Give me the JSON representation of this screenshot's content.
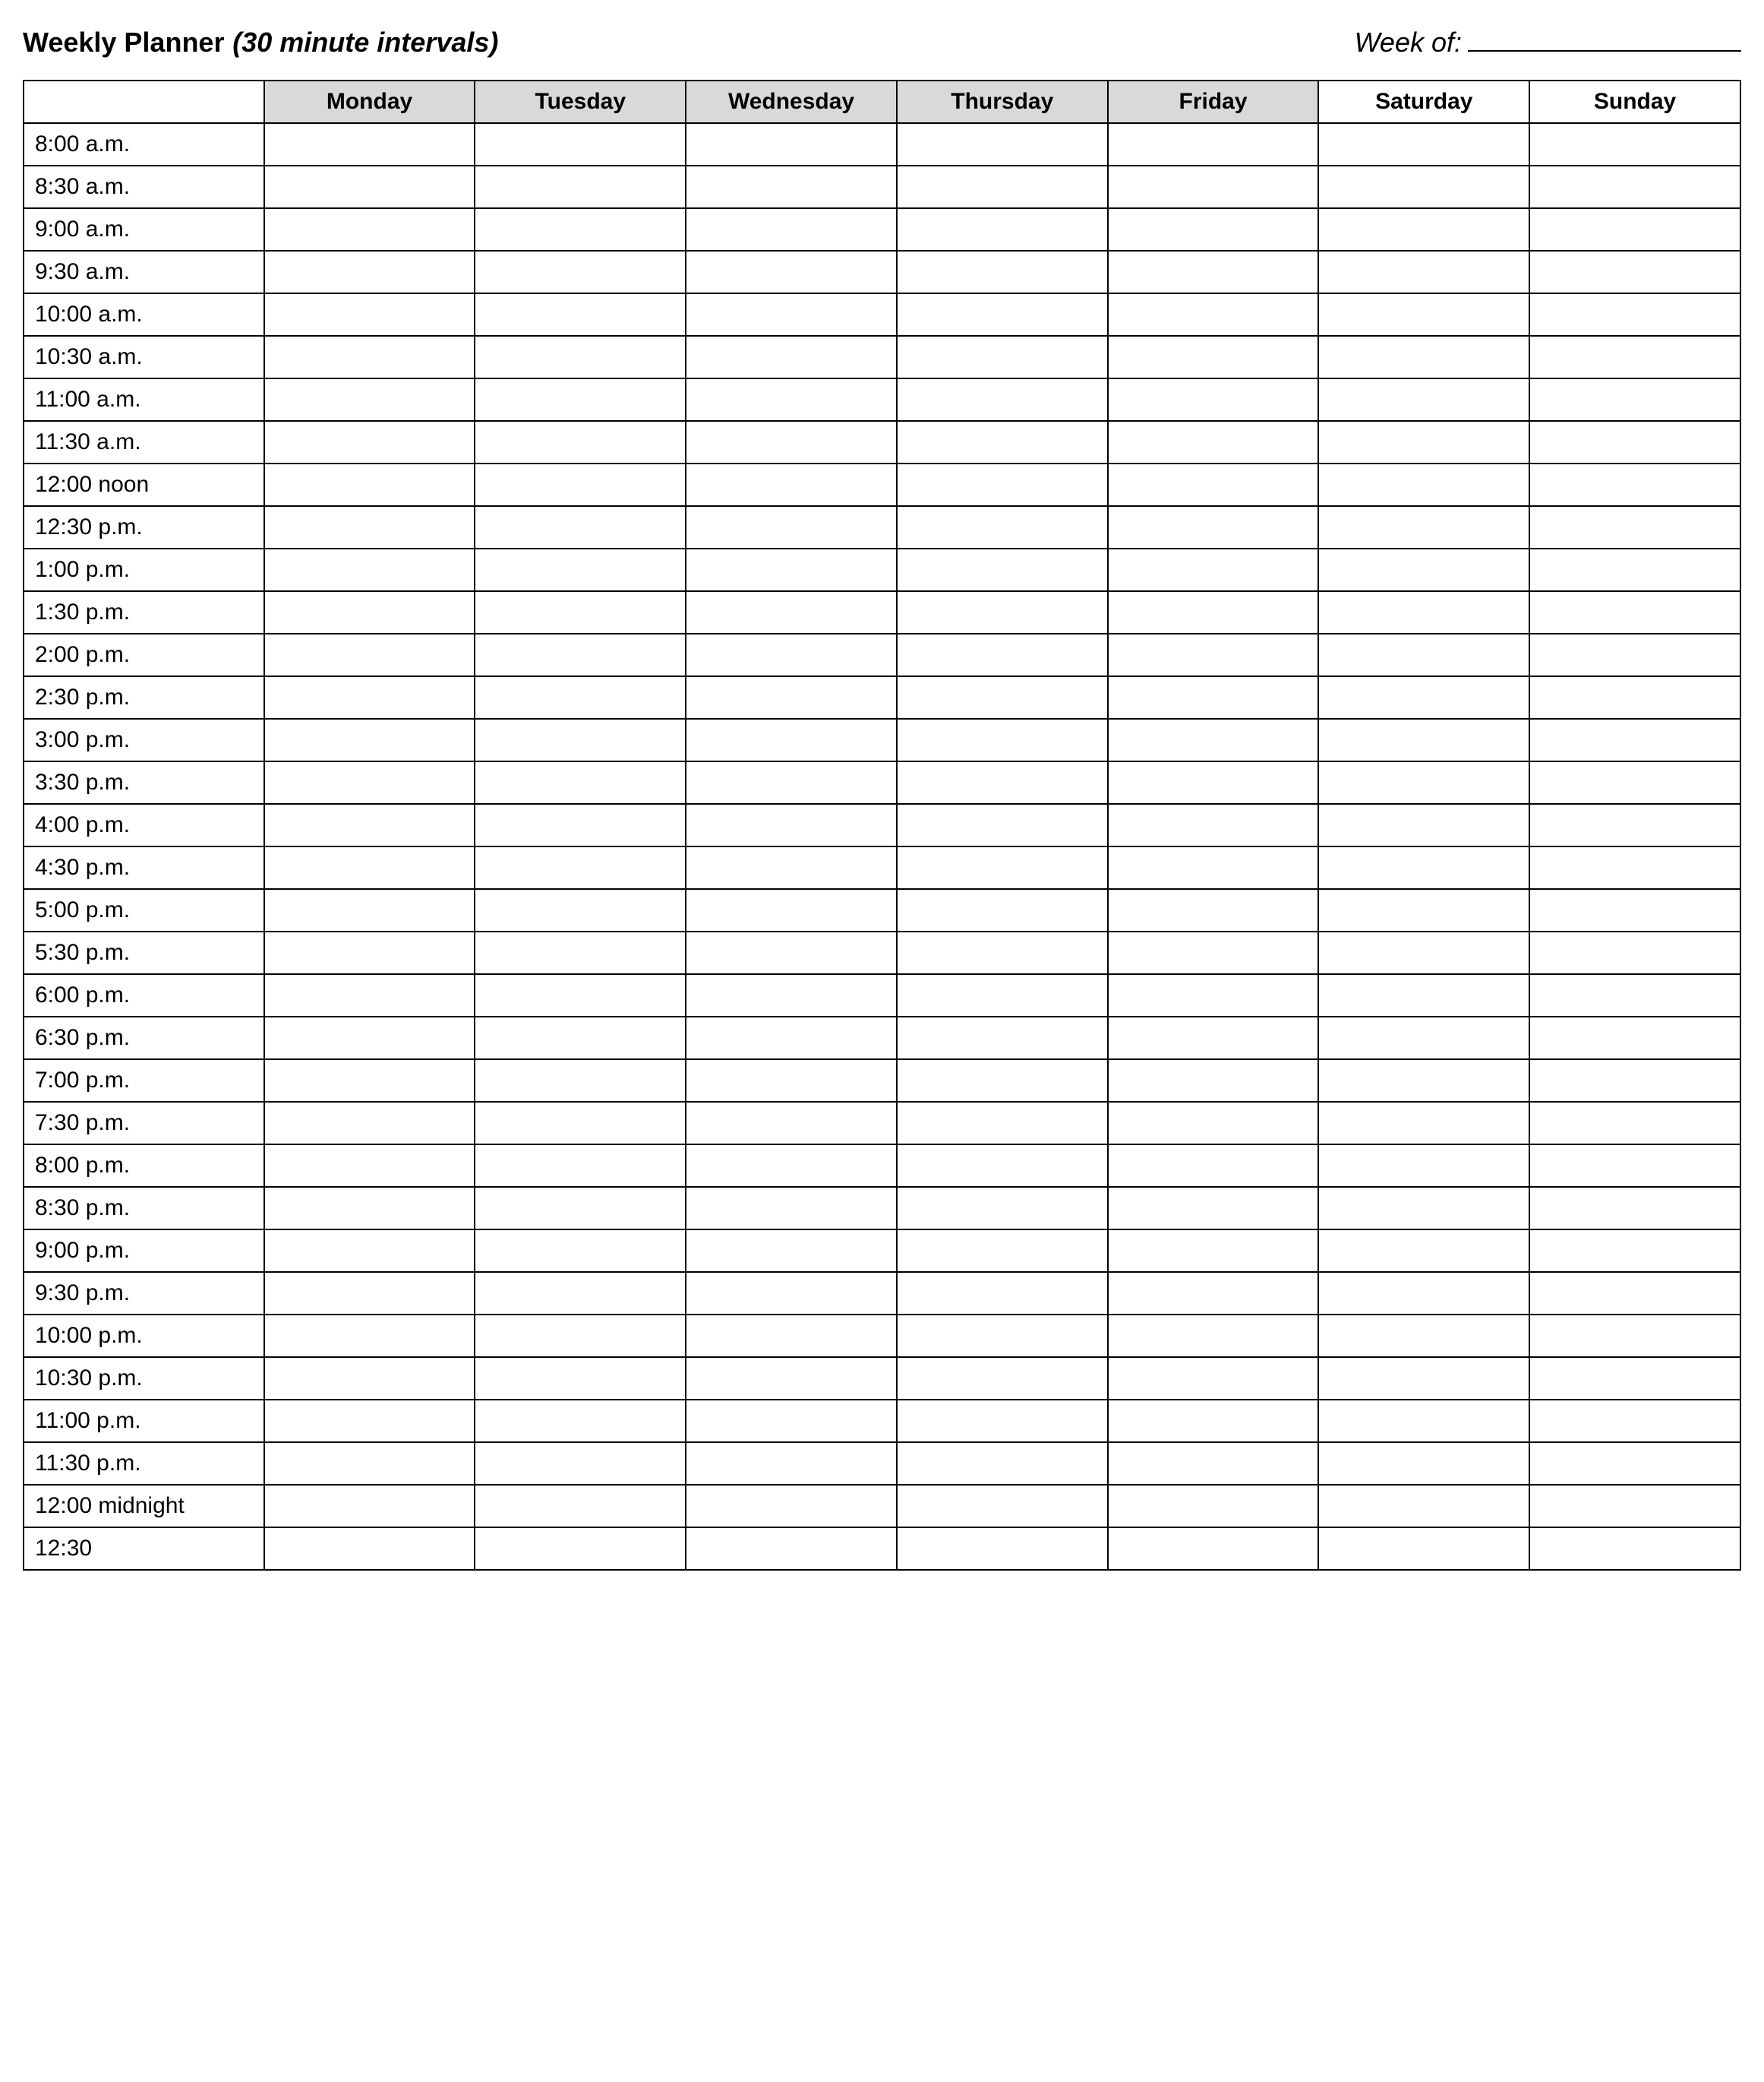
{
  "header": {
    "title_main": "Weekly Planner",
    "title_sub": "(30 minute intervals)",
    "weekof_label": "Week of:",
    "weekof_value": ""
  },
  "days": [
    {
      "label": "Monday",
      "shaded": true
    },
    {
      "label": "Tuesday",
      "shaded": true
    },
    {
      "label": "Wednesday",
      "shaded": true
    },
    {
      "label": "Thursday",
      "shaded": true
    },
    {
      "label": "Friday",
      "shaded": true
    },
    {
      "label": "Saturday",
      "shaded": false
    },
    {
      "label": "Sunday",
      "shaded": false
    }
  ],
  "times": [
    "8:00 a.m.",
    "8:30 a.m.",
    "9:00 a.m.",
    "9:30 a.m.",
    "10:00 a.m.",
    "10:30 a.m.",
    "11:00 a.m.",
    "11:30 a.m.",
    "12:00 noon",
    "12:30 p.m.",
    "1:00 p.m.",
    "1:30 p.m.",
    "2:00 p.m.",
    "2:30 p.m.",
    "3:00 p.m.",
    "3:30 p.m.",
    "4:00 p.m.",
    "4:30 p.m.",
    "5:00 p.m.",
    "5:30 p.m.",
    "6:00 p.m.",
    "6:30 p.m.",
    "7:00 p.m.",
    "7:30 p.m.",
    "8:00 p.m.",
    "8:30 p.m.",
    "9:00 p.m.",
    "9:30 p.m.",
    "10:00 p.m.",
    "10:30 p.m.",
    "11:00 p.m.",
    "11:30 p.m.",
    "12:00 midnight",
    "12:30"
  ]
}
